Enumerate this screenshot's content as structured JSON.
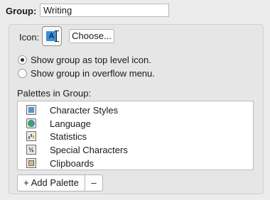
{
  "group": {
    "label": "Group:",
    "value": "Writing"
  },
  "icon": {
    "label": "Icon:",
    "glyph": "A",
    "choose_label": "Choose..."
  },
  "placement": {
    "options": [
      {
        "label": "Show group as top level icon.",
        "selected": true
      },
      {
        "label": "Show group in overflow menu.",
        "selected": false
      }
    ]
  },
  "palettes": {
    "label": "Palettes in Group:",
    "items": [
      {
        "label": "Character Styles",
        "icon": "character-styles-icon"
      },
      {
        "label": "Language",
        "icon": "language-globe-icon"
      },
      {
        "label": "Statistics",
        "icon": "statistics-chart-icon"
      },
      {
        "label": "Special Characters",
        "icon": "special-characters-icon",
        "glyph": "½"
      },
      {
        "label": "Clipboards",
        "icon": "clipboards-icon"
      }
    ]
  },
  "buttons": {
    "add_label": "+ Add Palette",
    "remove_label": "–"
  }
}
